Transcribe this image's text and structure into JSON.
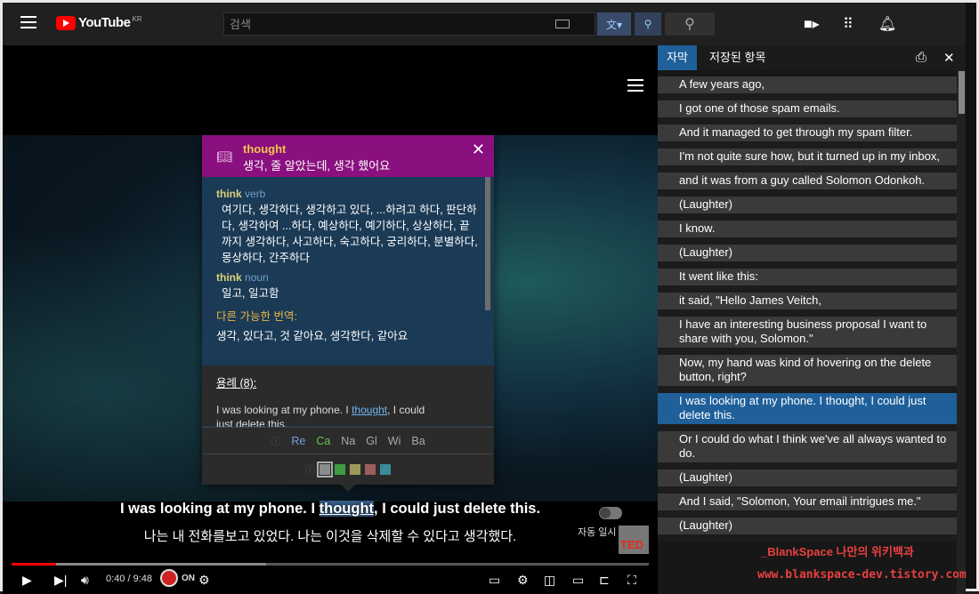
{
  "masthead": {
    "logo_text": "YouTube",
    "logo_region": "KR",
    "search_placeholder": "검색"
  },
  "popup": {
    "word": "thought",
    "translation": "생각, 줄 알았는데, 생각 했어요",
    "entries": [
      {
        "word": "think",
        "type": "verb",
        "meanings": "여기다, 생각하다, 생각하고 있다, ...하려고 하다, 판단하다, 생각하여 ...하다, 예상하다, 예기하다, 상상하다, 끝까지 생각하다, 사고하다, 숙고하다, 궁리하다, 분별하다, 몽상하다, 간주하다"
      },
      {
        "word": "think",
        "type": "noun",
        "meanings": "일고, 일고함"
      }
    ],
    "other_label": "다른 가능한 번역:",
    "other_value": "생각, 있다고, 것 같아요, 생각한다, 같아요",
    "examples_label": "용례 (8):",
    "example_before": "I was looking at my phone. I ",
    "example_word": "thought",
    "example_after": ", I could",
    "example_line2": "just delete this.",
    "dict_tabs": [
      {
        "label": "Re",
        "color": "#6fa2d9"
      },
      {
        "label": "Ca",
        "color": "#6cc24a"
      },
      {
        "label": "Na",
        "color": "#aaaaaa"
      },
      {
        "label": "Gl",
        "color": "#aaaaaa"
      },
      {
        "label": "Wi",
        "color": "#aaaaaa"
      },
      {
        "label": "Ba",
        "color": "#aaaaaa"
      }
    ],
    "swatches": [
      "#8c8c8c",
      "#3f9a43",
      "#9a9a58",
      "#9b5e5e",
      "#3d8a98"
    ],
    "colors": {
      "header": "#8a0f7f",
      "body": "#1b3a55"
    }
  },
  "captions": {
    "en_before": "I was looking at my phone. I ",
    "en_highlight": "thought",
    "en_after": ", I could just delete this.",
    "ko": "나는 내 전화를보고 있었다. 나는 이것을 삭제할 수 있다고 생각했다."
  },
  "player": {
    "time": "0:40 / 9:48",
    "on_label": "ON",
    "autoplay_label": "자동 일시",
    "ted_label": "TED",
    "progress_played_pct": 7,
    "progress_loaded_pct": 40
  },
  "panel": {
    "tabs": [
      "자막",
      "저장된 항목"
    ],
    "lines": [
      {
        "text": "A few years ago,",
        "active": false
      },
      {
        "text": "I got one of those spam emails.",
        "active": false
      },
      {
        "text": "And it managed to get through my spam filter.",
        "active": false
      },
      {
        "text": "I'm not quite sure how, but it turned up in my inbox,",
        "active": false
      },
      {
        "text": "and it was from a guy called Solomon Odonkoh.",
        "active": false
      },
      {
        "text": "(Laughter)",
        "active": false
      },
      {
        "text": "I know.",
        "active": false
      },
      {
        "text": "(Laughter)",
        "active": false
      },
      {
        "text": "It went like this:",
        "active": false
      },
      {
        "text": "it said, \"Hello James Veitch,",
        "active": false
      },
      {
        "text": "I have an interesting business proposal I want to share with you, Solomon.\"",
        "active": false
      },
      {
        "text": "Now, my hand was kind of hovering on the delete button, right?",
        "active": false
      },
      {
        "text": "I was looking at my phone. I thought, I could just delete this.",
        "active": true
      },
      {
        "text": "Or I could do what I think we've all always wanted to do.",
        "active": false
      },
      {
        "text": "(Laughter)",
        "active": false
      },
      {
        "text": "And I said, \"Solomon, Your email intrigues me.\"",
        "active": false
      },
      {
        "text": "(Laughter)",
        "active": false
      }
    ]
  },
  "watermark": {
    "line1": "_BlankSpace 나만의 위키백과",
    "line2": "www.blankspace-dev.tistory.com"
  }
}
